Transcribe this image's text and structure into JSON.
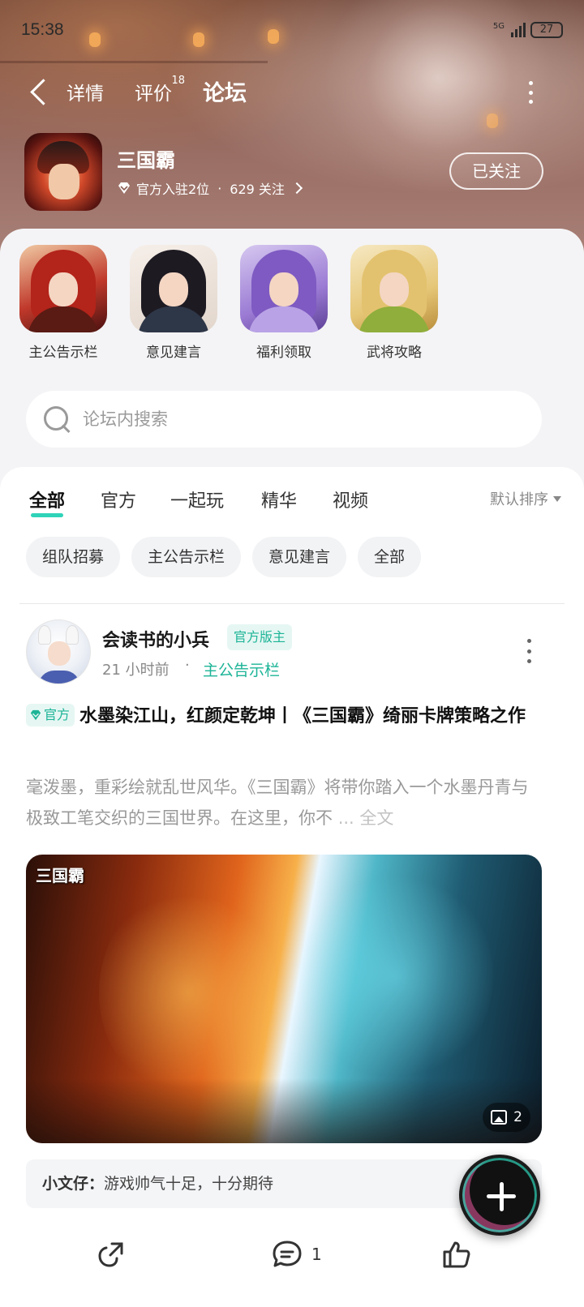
{
  "status_bar": {
    "time": "15:38",
    "network": "5G",
    "battery": "27"
  },
  "nav": {
    "tabs": [
      {
        "label": "详情"
      },
      {
        "label": "评价",
        "badge": "18"
      },
      {
        "label": "论坛",
        "active": true
      }
    ]
  },
  "game": {
    "name": "三国霸",
    "official_count": "官方入驻2位",
    "separator": "·",
    "followers": "629 关注",
    "follow_button": "已关注"
  },
  "boards": [
    {
      "label": "主公告示栏",
      "icon": "general-red-armor-avatar"
    },
    {
      "label": "意见建言",
      "icon": "lady-black-hair-avatar"
    },
    {
      "label": "福利领取",
      "icon": "lady-purple-hair-avatar"
    },
    {
      "label": "武将攻略",
      "icon": "lady-blonde-fan-avatar"
    }
  ],
  "search": {
    "placeholder": "论坛内搜索"
  },
  "filter_tabs": [
    "全部",
    "官方",
    "一起玩",
    "精华",
    "视频"
  ],
  "sort_label": "默认排序",
  "chips": [
    "组队招募",
    "主公告示栏",
    "意见建言",
    "全部"
  ],
  "post": {
    "author": "会读书的小兵",
    "author_badge": "官方版主",
    "time": "21 小时前",
    "dot": "·",
    "board": "主公告示栏",
    "official_tag": "官方",
    "title": "水墨染江山，红颜定乾坤丨《三国霸》绮丽卡牌策略之作",
    "excerpt": "毫泼墨，重彩绘就乱世风华。《三国霸》将带你踏入一个水墨丹青与极致工笔交织的三国世界。在这里，你不",
    "more": "... 全文",
    "image_logo": "三国霸",
    "image_count": "2",
    "comment_author": "小文仔：",
    "comment_text": "游戏帅气十足，十分期待",
    "comment_count": "1"
  },
  "colors": {
    "accent": "#2fd3b8",
    "accent_text": "#1db497"
  },
  "icons": [
    "back-icon",
    "more-icon",
    "diamond-icon",
    "chevron-right-icon",
    "search-icon",
    "sort-caret-icon",
    "share-icon",
    "comment-icon",
    "like-icon",
    "gallery-icon",
    "plus-icon"
  ]
}
